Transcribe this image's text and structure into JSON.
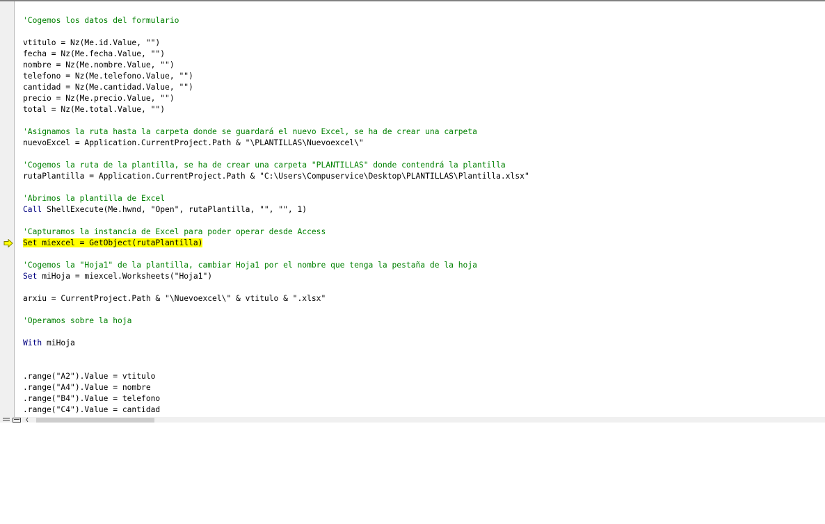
{
  "editor": {
    "execution_line_index": 20,
    "lines": [
      {
        "type": "comment",
        "text": "'Cogemos los datos del formulario"
      },
      {
        "type": "blank",
        "text": ""
      },
      {
        "type": "code",
        "text": "vtitulo = Nz(Me.id.Value, \"\")"
      },
      {
        "type": "code",
        "text": "fecha = Nz(Me.fecha.Value, \"\")"
      },
      {
        "type": "code",
        "text": "nombre = Nz(Me.nombre.Value, \"\")"
      },
      {
        "type": "code",
        "text": "telefono = Nz(Me.telefono.Value, \"\")"
      },
      {
        "type": "code",
        "text": "cantidad = Nz(Me.cantidad.Value, \"\")"
      },
      {
        "type": "code",
        "text": "precio = Nz(Me.precio.Value, \"\")"
      },
      {
        "type": "code",
        "text": "total = Nz(Me.total.Value, \"\")"
      },
      {
        "type": "blank",
        "text": ""
      },
      {
        "type": "comment",
        "text": "'Asignamos la ruta hasta la carpeta donde se guardará el nuevo Excel, se ha de crear una carpeta"
      },
      {
        "type": "code",
        "text": "nuevoExcel = Application.CurrentProject.Path & \"\\PLANTILLAS\\Nuevoexcel\\\""
      },
      {
        "type": "blank",
        "text": ""
      },
      {
        "type": "comment",
        "text": "'Cogemos la ruta de la plantilla, se ha de crear una carpeta \"PLANTILLAS\" donde contendrá la plantilla"
      },
      {
        "type": "code",
        "text": "rutaPlantilla = Application.CurrentProject.Path & \"C:\\Users\\Compuservice\\Desktop\\PLANTILLAS\\Plantilla.xlsx\""
      },
      {
        "type": "blank",
        "text": ""
      },
      {
        "type": "comment",
        "text": "'Abrimos la plantilla de Excel"
      },
      {
        "type": "kwcode",
        "kw": "Call",
        "text": " ShellExecute(Me.hwnd, \"Open\", rutaPlantilla, \"\", \"\", 1)"
      },
      {
        "type": "blank",
        "text": ""
      },
      {
        "type": "comment",
        "text": "'Capturamos la instancia de Excel para poder operar desde Access"
      },
      {
        "type": "highlight",
        "text": "Set miexcel = GetObject(rutaPlantilla)"
      },
      {
        "type": "blank",
        "text": ""
      },
      {
        "type": "comment",
        "text": "'Cogemos la \"Hoja1\" de la plantilla, cambiar Hoja1 por el nombre que tenga la pestaña de la hoja"
      },
      {
        "type": "kwcode",
        "kw": "Set",
        "text": " miHoja = miexcel.Worksheets(\"Hoja1\")"
      },
      {
        "type": "blank",
        "text": ""
      },
      {
        "type": "code",
        "text": "arxiu = CurrentProject.Path & \"\\Nuevoexcel\\\" & vtitulo & \".xlsx\""
      },
      {
        "type": "blank",
        "text": ""
      },
      {
        "type": "comment",
        "text": "'Operamos sobre la hoja"
      },
      {
        "type": "blank",
        "text": ""
      },
      {
        "type": "kwcode",
        "kw": "With",
        "text": " miHoja"
      },
      {
        "type": "blank",
        "text": ""
      },
      {
        "type": "blank",
        "text": ""
      },
      {
        "type": "code",
        "text": ".range(\"A2\").Value = vtitulo"
      },
      {
        "type": "code",
        "text": ".range(\"A4\").Value = nombre"
      },
      {
        "type": "code",
        "text": ".range(\"B4\").Value = telefono"
      },
      {
        "type": "code",
        "text": ".range(\"C4\").Value = cantidad"
      }
    ]
  },
  "colors": {
    "comment": "#008000",
    "keyword": "#000080",
    "highlight": "#ffff00",
    "arrow_fill": "#ffff00",
    "arrow_stroke": "#808000"
  },
  "icons": {
    "execution": "execution-point-arrow-icon",
    "procedure_view": "procedure-view-icon",
    "full_module_view": "full-module-view-icon"
  }
}
